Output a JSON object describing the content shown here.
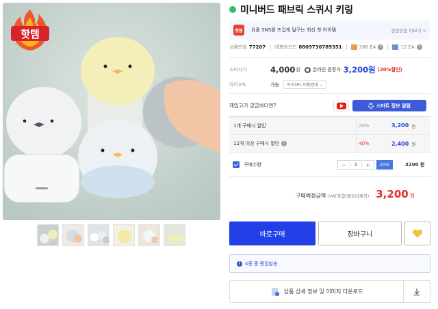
{
  "hero": {
    "badge_text": "핫템"
  },
  "thumbnails": [
    "thumb-1",
    "thumb-2",
    "thumb-3",
    "thumb-4",
    "thumb-5",
    "thumb-6"
  ],
  "product": {
    "title": "미니버드 패브릭 스퀴시 키링",
    "status_color": "#2fc06e"
  },
  "promo": {
    "logo": "핫템",
    "text": "요즘 SNS를 뜨겁게 달구는 최신 핫 아이템",
    "more": "관련상품 더보기 >"
  },
  "codes": {
    "product_no_label": "상품번호",
    "product_no": "77207",
    "barcode_label": "대표바코드",
    "barcode": "8809730789351",
    "box_qty": "288 EA",
    "inner_qty": "12 EA"
  },
  "pricing": {
    "consumer_label": "소비자가",
    "consumer_price": "4,000",
    "won": "원",
    "online_label": "온라인 권장가",
    "online_price": "3,200원",
    "discount": "(20%할인)"
  },
  "pl": {
    "label": "아이3PL",
    "value": "가능",
    "select": "아이3PL 비용안내"
  },
  "stock": {
    "question": "재입고가 궁금하다면?",
    "smart_btn": "스마트 정보 알림"
  },
  "discounts": [
    {
      "name": "1개 구매시 할인",
      "pct": "20%",
      "price": "3,200",
      "won": "원",
      "has_help": false
    },
    {
      "name": "12개 이상 구매시 할인",
      "pct": "40%",
      "price": "2,400",
      "won": "원",
      "has_help": true
    }
  ],
  "quantity": {
    "label": "구매수량",
    "minus": "−",
    "value": "1",
    "plus": "+",
    "pct": "20%",
    "total": "3200 원"
  },
  "total": {
    "label": "구매예정금액",
    "sub": "(VAT포함/배송비제외)",
    "price": "3,200",
    "won": "원"
  },
  "actions": {
    "buy": "바로구매",
    "cart": "장바구니"
  },
  "notice": {
    "text": "4종 중 랜덤발송"
  },
  "download": {
    "text": "상품 상세 정보 및 이미지 다운로드"
  },
  "colors": {
    "accent": "#2340e8",
    "price_red": "#e8292a",
    "price_blue": "#2445d8"
  }
}
